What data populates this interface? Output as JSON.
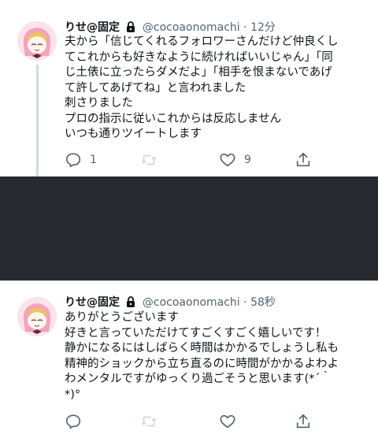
{
  "tweets": [
    {
      "name": "りせ@固定",
      "handle": "@cocoaonomachi",
      "sep": "·",
      "time": "12分",
      "lines": [
        "夫から「信じてくれるフォロワーさんだけど仲良くし",
        "てこれからも好きなように続ければいいじゃん」「同",
        "じ土俵に立ったらダメだよ」「相手を恨まないであげ",
        "て許してあげてね」と言われました",
        "刺さりました",
        "プロの指示に従いこれからは反応しません",
        "いつも通りツイートします"
      ],
      "reply_count": "1",
      "retweet_count": "",
      "like_count": "9"
    },
    {
      "name": "りせ@固定",
      "handle": "@cocoaonomachi",
      "sep": "·",
      "time": "58秒",
      "lines": [
        "ありがとうございます",
        "好きと言っていただけてすごくすごく嬉しいです！",
        "静かになるにはしばらく時間はかかるでしょうし私も",
        "精神的ショックから立ち直るのに時間がかかるよわよ",
        "わメンタルですがゆっくり過ごそうと思います(*´｀",
        "*)°"
      ],
      "reply_count": "",
      "retweet_count": "",
      "like_count": ""
    }
  ],
  "colors": {
    "text": "#0f1419",
    "muted": "#536471",
    "redaction": "#272b30",
    "thread_line": "#cfd9de"
  },
  "icons": [
    "lock-icon",
    "reply-icon",
    "retweet-icon",
    "like-icon",
    "share-icon"
  ]
}
